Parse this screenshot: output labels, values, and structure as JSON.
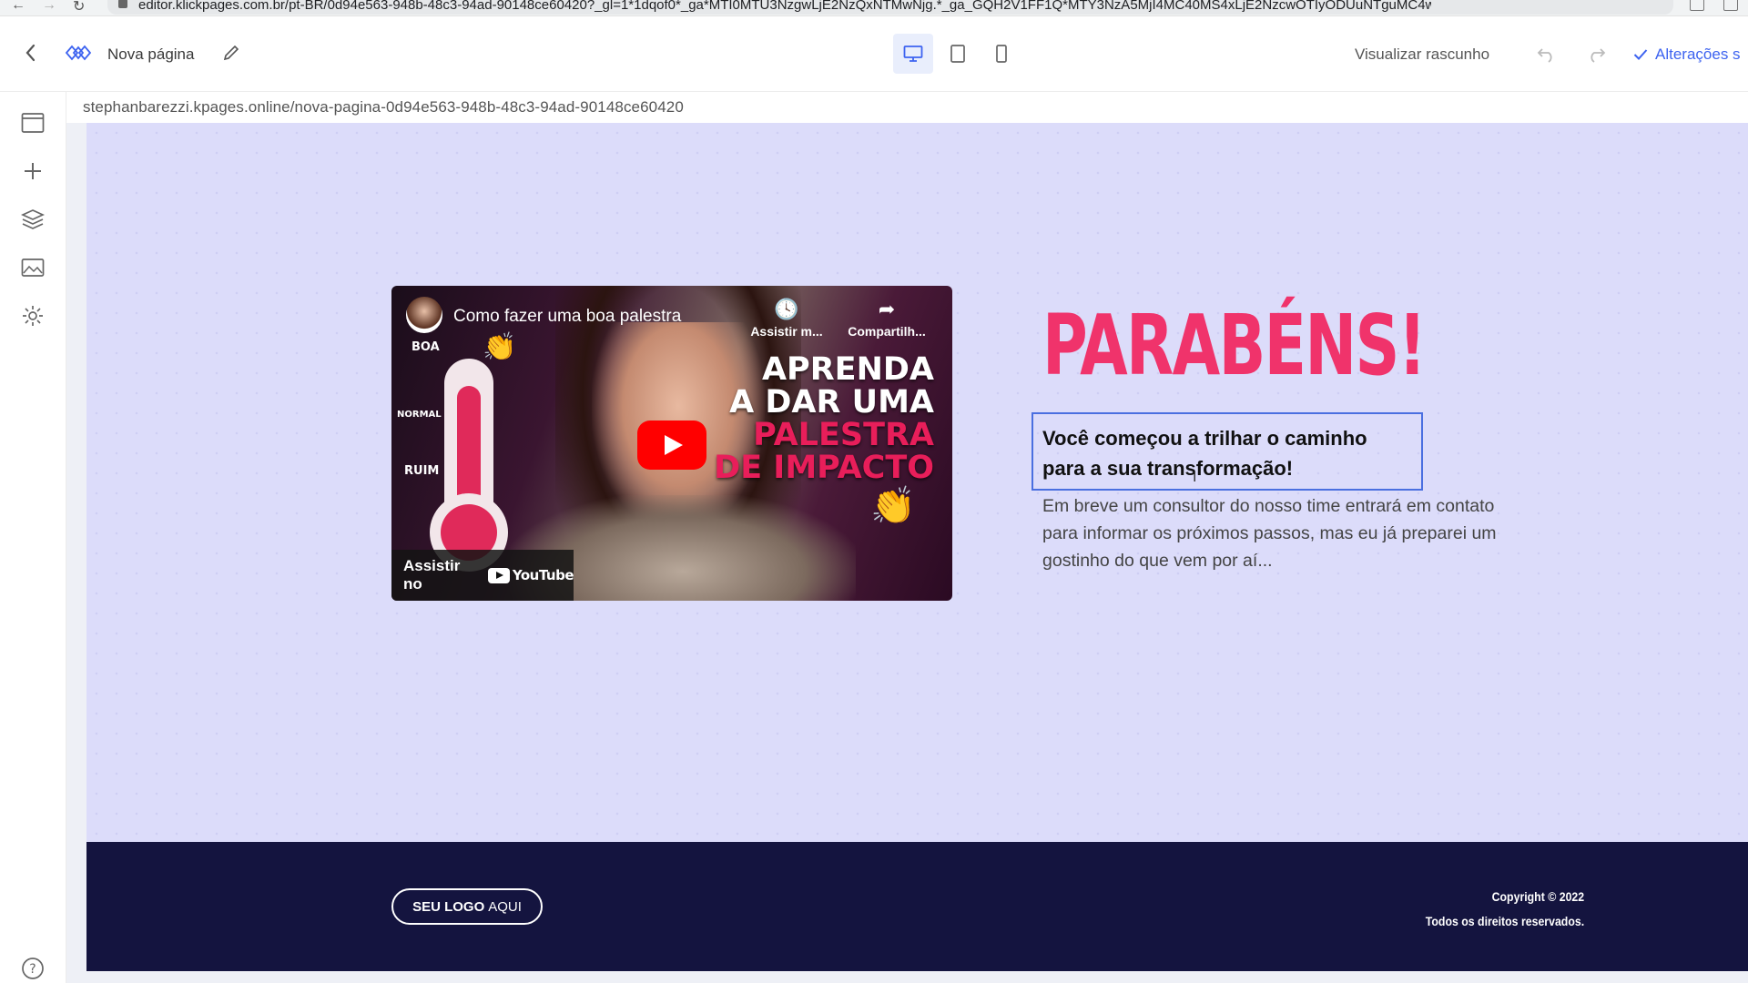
{
  "browser": {
    "url": "editor.klickpages.com.br/pt-BR/0d94e563-948b-48c3-94ad-90148ce60420?_gl=1*1dqof0*_ga*MTI0MTU3NzgwLjE2NzQxNTMwNjg.*_ga_GQH2V1FF1Q*MTY3NzA5MjI4MC40MS4xLjE2NzcwOTIyODUuNTguMC4w"
  },
  "toolbar": {
    "page_name": "Nova página",
    "draft_label": "Visualizar rascunho",
    "saved_label": "Alterações s"
  },
  "page_url": "stephanbarezzi.kpages.online/nova-pagina-0d94e563-948b-48c3-94ad-90148ce60420",
  "video": {
    "title": "Como fazer uma boa palestra",
    "watch_later": "Assistir m...",
    "share": "Compartilh...",
    "watch_on": "Assistir no",
    "youtube": "YouTube",
    "headline_line1": "APRENDA",
    "headline_line2": "A DAR UMA",
    "headline_line3": "PALESTRA",
    "headline_line4": "DE IMPACTO",
    "scale_good": "BOA",
    "scale_normal": "NORMAL",
    "scale_bad": "RUIM"
  },
  "hero": {
    "title": "PARABÉNS!",
    "subtitle": "Você começou a trilhar o caminho para a sua transformação!",
    "body": "Em breve um consultor do nosso time entrará em contato para informar os próximos passos, mas eu já preparei um gostinho do que vem por aí..."
  },
  "footer": {
    "logo_bold": "SEU LOGO",
    "logo_light": "AQUI",
    "copyright": "Copyright © 2022",
    "rights": "Todos os direitos reservados."
  },
  "colors": {
    "accent": "#3d63f0",
    "hero_bg": "#dcdcfa",
    "title_pink": "#f0336b",
    "footer_bg": "#14143f"
  }
}
